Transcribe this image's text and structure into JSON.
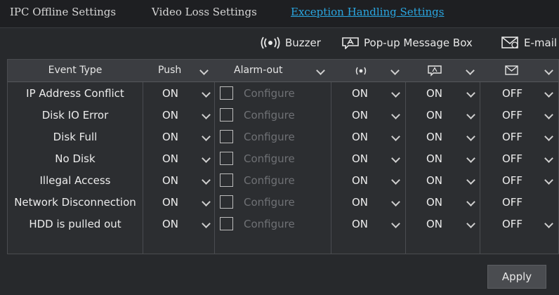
{
  "tabs": [
    {
      "label": "IPC Offline Settings"
    },
    {
      "label": "Video Loss Settings"
    },
    {
      "label": "Exception Handling Settings"
    }
  ],
  "legend": {
    "buzzer_label": "Buzzer",
    "popup_label": "Pop-up Message Box",
    "email_label": "E-mail"
  },
  "table": {
    "headers": {
      "event_type": "Event Type",
      "push": "Push",
      "alarm_out": "Alarm-out"
    },
    "configure_label": "Configure",
    "rows": [
      {
        "event": "IP Address Conflict",
        "push": "ON",
        "buzzer": "ON",
        "popup": "ON",
        "email": "OFF"
      },
      {
        "event": "Disk IO Error",
        "push": "ON",
        "buzzer": "ON",
        "popup": "ON",
        "email": "OFF"
      },
      {
        "event": "Disk Full",
        "push": "ON",
        "buzzer": "ON",
        "popup": "ON",
        "email": "OFF"
      },
      {
        "event": "No Disk",
        "push": "ON",
        "buzzer": "ON",
        "popup": "ON",
        "email": "OFF"
      },
      {
        "event": "Illegal Access",
        "push": "ON",
        "buzzer": "ON",
        "popup": "ON",
        "email": "OFF"
      },
      {
        "event": "Network Disconnection",
        "push": "ON",
        "buzzer": "ON",
        "popup": "ON",
        "email": "OFF"
      },
      {
        "event": "HDD is pulled out",
        "push": "ON",
        "buzzer": "ON",
        "popup": "ON",
        "email": "OFF"
      }
    ]
  },
  "apply_label": "Apply",
  "colors": {
    "background": "#27292c",
    "active_tab": "#2aa6e0",
    "header": "#3b3d41"
  }
}
